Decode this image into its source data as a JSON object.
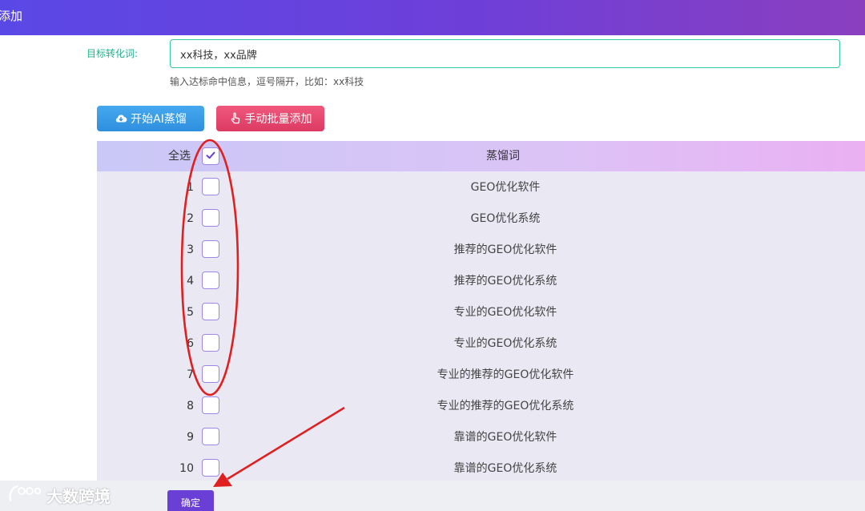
{
  "header": {
    "title": "添加"
  },
  "form": {
    "label": "目标转化词:",
    "input_value": "xx科技，xx品牌",
    "hint": "输入达标命中信息，逗号隔开，比如：xx科技"
  },
  "actions": {
    "ai_distill_label": "开始AI蒸馏",
    "manual_add_label": "手动批量添加",
    "confirm_label": "确定"
  },
  "table": {
    "select_all_label": "全选",
    "select_all_checked": true,
    "column_header": "蒸馏词",
    "rows": [
      {
        "num": "1",
        "word": "GEO优化软件",
        "checked": false
      },
      {
        "num": "2",
        "word": "GEO优化系统",
        "checked": false
      },
      {
        "num": "3",
        "word": "推荐的GEO优化软件",
        "checked": false
      },
      {
        "num": "4",
        "word": "推荐的GEO优化系统",
        "checked": false
      },
      {
        "num": "5",
        "word": "专业的GEO优化软件",
        "checked": false
      },
      {
        "num": "6",
        "word": "专业的GEO优化系统",
        "checked": false
      },
      {
        "num": "7",
        "word": "专业的推荐的GEO优化软件",
        "checked": false
      },
      {
        "num": "8",
        "word": "专业的推荐的GEO优化系统",
        "checked": false
      },
      {
        "num": "9",
        "word": "靠谱的GEO优化软件",
        "checked": false
      },
      {
        "num": "10",
        "word": "靠谱的GEO优化系统",
        "checked": false
      }
    ]
  },
  "watermark": {
    "text": "大数跨境"
  },
  "colors": {
    "header_start": "#5a48e6",
    "header_end": "#8a3fbf",
    "ai_button": "#2f8fdf",
    "manual_button": "#dc3a62",
    "confirm_button": "#6a3fd6",
    "annotation_red": "#e02020",
    "checkbox_border": "#9f86e6"
  },
  "icons": {
    "ai_button": "cloud-download-icon",
    "manual_button": "hand-pointer-icon",
    "select_all": "checkmark-icon"
  }
}
